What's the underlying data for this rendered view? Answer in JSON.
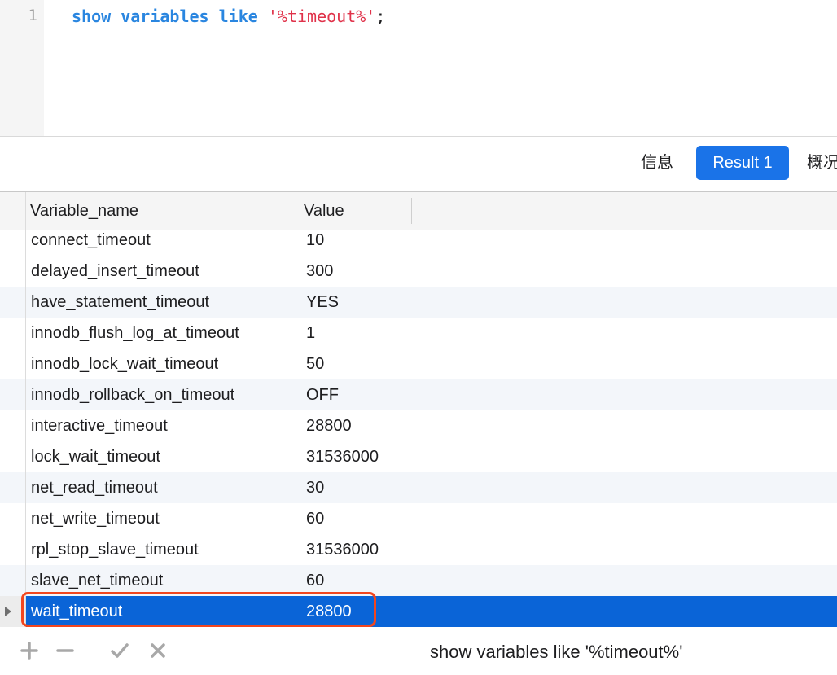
{
  "editor": {
    "line_number": "1",
    "tokens": {
      "kw1": "show",
      "kw2": "variables",
      "kw3": "like",
      "string": "'%timeout%'",
      "terminator": ";"
    }
  },
  "tabs": {
    "info": "信息",
    "result": "Result 1",
    "overview": "概况"
  },
  "grid": {
    "columns": [
      "Variable_name",
      "Value"
    ],
    "rows": [
      {
        "name": "connect_timeout",
        "value": "10"
      },
      {
        "name": "delayed_insert_timeout",
        "value": "300"
      },
      {
        "name": "have_statement_timeout",
        "value": "YES"
      },
      {
        "name": "innodb_flush_log_at_timeout",
        "value": "1"
      },
      {
        "name": "innodb_lock_wait_timeout",
        "value": "50"
      },
      {
        "name": "innodb_rollback_on_timeout",
        "value": "OFF"
      },
      {
        "name": "interactive_timeout",
        "value": "28800"
      },
      {
        "name": "lock_wait_timeout",
        "value": "31536000"
      },
      {
        "name": "net_read_timeout",
        "value": "30"
      },
      {
        "name": "net_write_timeout",
        "value": "60"
      },
      {
        "name": "rpl_stop_slave_timeout",
        "value": "31536000"
      },
      {
        "name": "slave_net_timeout",
        "value": "60"
      },
      {
        "name": "wait_timeout",
        "value": "28800"
      }
    ],
    "selected_row": "wait_timeout"
  },
  "footer": {
    "icons": [
      "plus-icon",
      "minus-icon",
      "check-icon",
      "close-icon"
    ],
    "status_sql": "show variables like '%timeout%'"
  },
  "colors": {
    "accent": "#1a73e8",
    "selected_row": "#0a64d7",
    "highlight_box": "#f2461e",
    "keyword": "#2a86e0",
    "string": "#e0324a"
  }
}
